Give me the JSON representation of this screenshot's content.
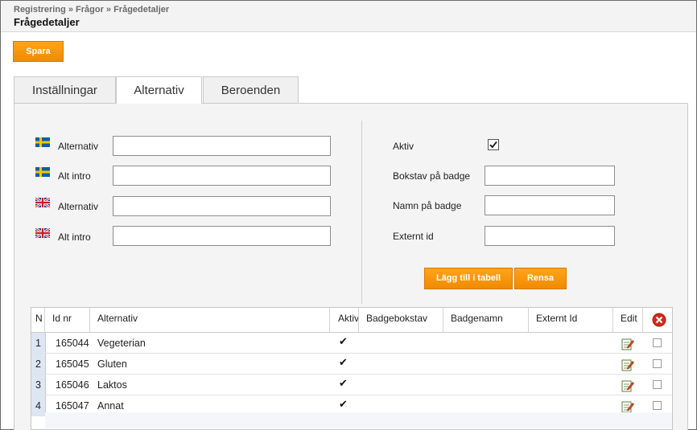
{
  "header": {
    "breadcrumb": "Registrering » Frågor » Frågedetaljer",
    "title": "Frågedetaljer"
  },
  "toolbar": {
    "save_label": "Spara"
  },
  "tabs": [
    {
      "label": "Inställningar",
      "active": false
    },
    {
      "label": "Alternativ",
      "active": true
    },
    {
      "label": "Beroenden",
      "active": false
    }
  ],
  "form_left": [
    {
      "flag": "sweden-flag-icon",
      "label": "Alternativ",
      "value": ""
    },
    {
      "flag": "sweden-flag-icon",
      "label": "Alt intro",
      "value": ""
    },
    {
      "flag": "uk-flag-icon",
      "label": "Alternativ",
      "value": ""
    },
    {
      "flag": "uk-flag-icon",
      "label": "Alt intro",
      "value": ""
    }
  ],
  "form_right": {
    "aktiv_label": "Aktiv",
    "aktiv_checked": true,
    "fields": [
      {
        "label": "Bokstav på badge",
        "value": ""
      },
      {
        "label": "Namn på badge",
        "value": ""
      },
      {
        "label": "Externt id",
        "value": ""
      }
    ],
    "add_label": "Lägg till i tabell",
    "clear_label": "Rensa"
  },
  "grid": {
    "columns": [
      "N",
      "Id nr",
      "Alternativ",
      "Aktiv",
      "Badgebokstav",
      "Badgenamn",
      "Externt Id",
      "Edit"
    ],
    "rows": [
      {
        "n": "1",
        "id": "165044",
        "alt": "Vegeterian",
        "aktiv": "✔"
      },
      {
        "n": "2",
        "id": "165045",
        "alt": "Gluten",
        "aktiv": "✔"
      },
      {
        "n": "3",
        "id": "165046",
        "alt": "Laktos",
        "aktiv": "✔"
      },
      {
        "n": "4",
        "id": "165047",
        "alt": "Annat",
        "aktiv": "✔"
      }
    ]
  },
  "colors": {
    "accent": "#f59300",
    "row_number_bg": "#dde7f3",
    "panel_bg": "#f4f4f4"
  }
}
